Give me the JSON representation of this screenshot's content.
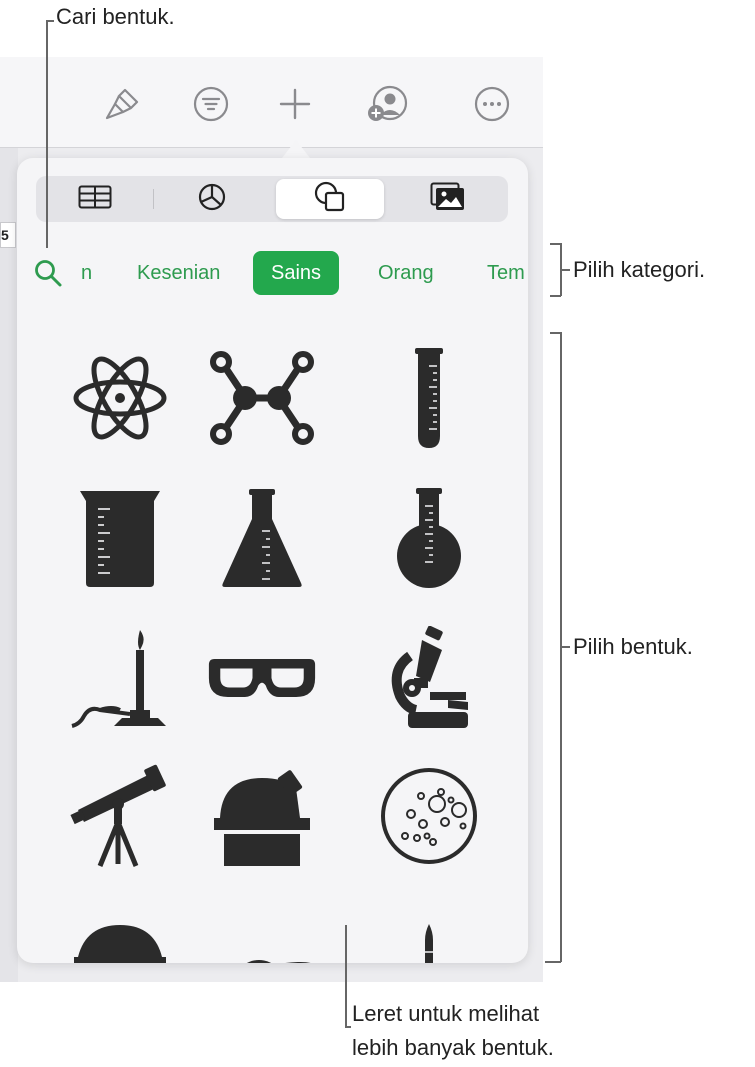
{
  "callouts": {
    "search": "Cari bentuk.",
    "category": "Pilih kategori.",
    "shape": "Pilih bentuk.",
    "scroll_line1": "Leret untuk melihat",
    "scroll_line2": "lebih banyak bentuk."
  },
  "background": {
    "cell_text": "5",
    "toolbar_icons": [
      "paintbrush-icon",
      "format-filter-icon",
      "add-icon",
      "collaborate-icon",
      "more-icon"
    ]
  },
  "insert_popover": {
    "tabs": [
      {
        "icon": "table-icon",
        "selected": false
      },
      {
        "icon": "chart-icon",
        "selected": false
      },
      {
        "icon": "shapes-icon",
        "selected": true
      },
      {
        "icon": "media-icon",
        "selected": false
      }
    ],
    "categories": [
      "n",
      "Kesenian",
      "Sains",
      "Orang",
      "Tem"
    ],
    "selected_category": "Sains",
    "shapes": [
      "atom",
      "molecule",
      "test-tube",
      "beaker",
      "erlenmeyer-flask",
      "round-flask",
      "bunsen-burner",
      "goggles",
      "microscope",
      "telescope",
      "observatory",
      "petri-dish",
      "planetarium",
      "planet",
      "rocket"
    ]
  },
  "colors": {
    "accent": "#23a84d",
    "accent_text": "#2e9b4f",
    "shape_fill": "#2b2b2b"
  }
}
